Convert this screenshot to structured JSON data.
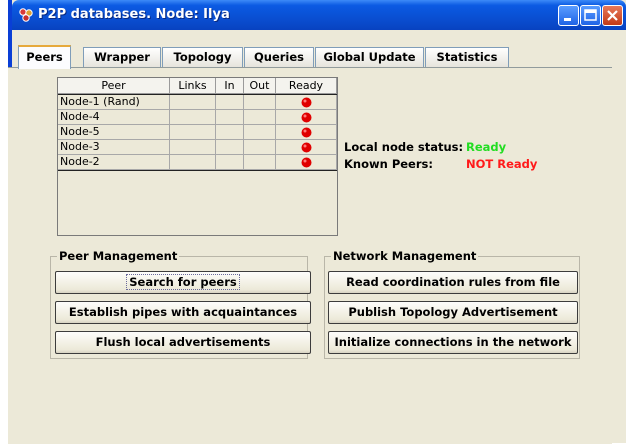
{
  "window": {
    "title": "P2P databases. Node: Ilya"
  },
  "tabs": [
    {
      "label": "Peers",
      "active": true
    },
    {
      "label": "Wrapper"
    },
    {
      "label": "Topology"
    },
    {
      "label": "Queries"
    },
    {
      "label": "Global Update"
    },
    {
      "label": "Statistics"
    }
  ],
  "peers_table": {
    "columns": [
      "Peer",
      "Links",
      "In",
      "Out",
      "Ready"
    ],
    "rows": [
      {
        "peer": "Node-1 (Rand)",
        "links": "",
        "in": "",
        "out": "",
        "ready": "red-dot-icon"
      },
      {
        "peer": "Node-4",
        "links": "",
        "in": "",
        "out": "",
        "ready": "red-dot-icon"
      },
      {
        "peer": "Node-5",
        "links": "",
        "in": "",
        "out": "",
        "ready": "red-dot-icon"
      },
      {
        "peer": "Node-3",
        "links": "",
        "in": "",
        "out": "",
        "ready": "red-dot-icon"
      },
      {
        "peer": "Node-2",
        "links": "",
        "in": "",
        "out": "",
        "ready": "red-dot-icon"
      }
    ]
  },
  "status": {
    "local_label": "Local node status:",
    "local_value": "Ready",
    "known_label": "Known Peers:",
    "known_value": "NOT Ready",
    "colors": {
      "ready": "#22dd22",
      "not_ready": "#ff1a1a"
    }
  },
  "peer_management": {
    "title": "Peer Management",
    "buttons": [
      "Search for peers",
      "Establish pipes with acquaintances",
      "Flush local advertisements"
    ]
  },
  "network_management": {
    "title": "Network Management",
    "buttons": [
      "Read coordination rules from file",
      "Publish Topology Advertisement",
      "Initialize connections in the network"
    ]
  }
}
